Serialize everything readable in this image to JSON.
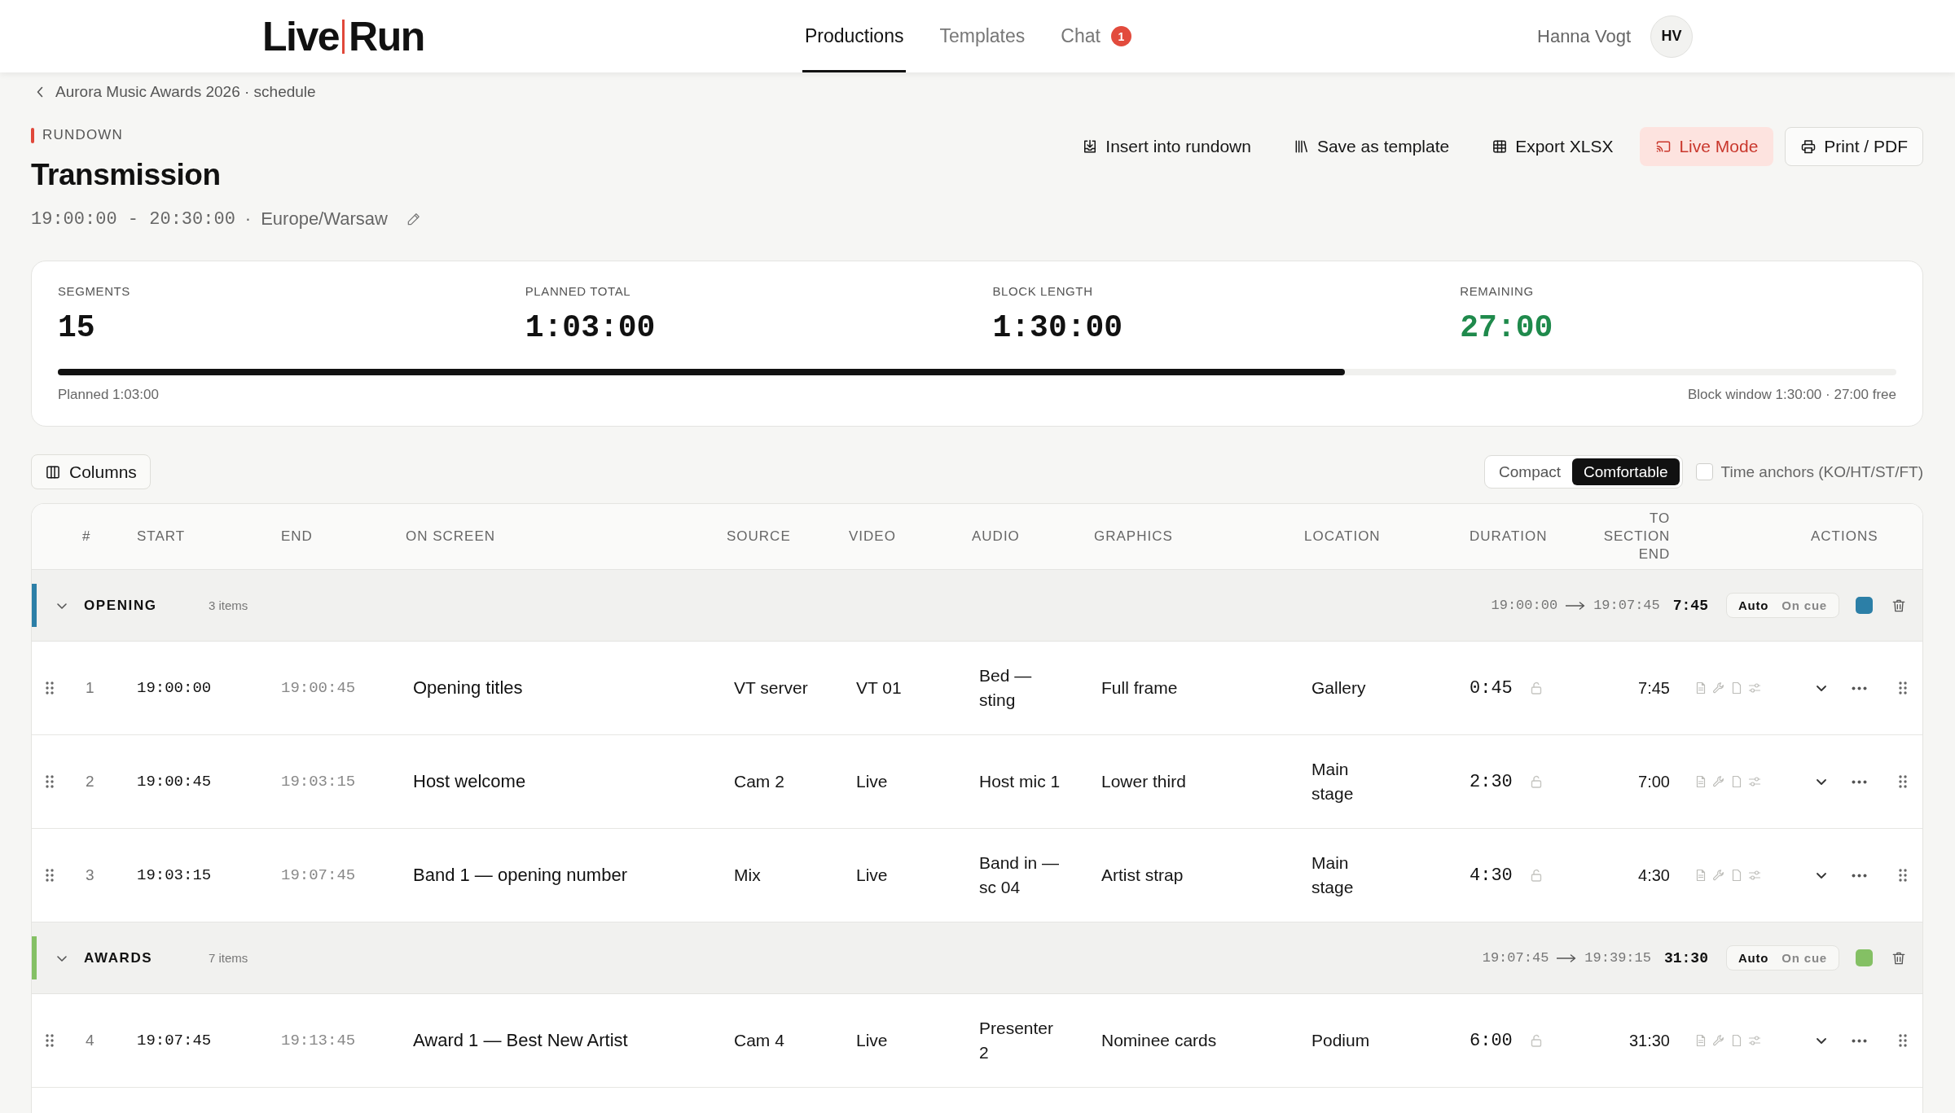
{
  "header": {
    "logo": {
      "left": "Live",
      "right": "Run"
    },
    "nav": [
      {
        "label": "Productions",
        "selected": true
      },
      {
        "label": "Templates",
        "selected": false
      },
      {
        "label": "Chat",
        "selected": false,
        "badge": "1"
      }
    ],
    "user": {
      "name": "Hanna Vogt",
      "initials": "HV"
    }
  },
  "breadcrumb": {
    "label": "Aurora Music Awards 2026 · schedule"
  },
  "page": {
    "eyebrow": "RUNDOWN",
    "title": "Transmission",
    "time_range": "19:00:00 - 20:30:00",
    "separator": "·",
    "timezone": "Europe/Warsaw"
  },
  "actions": [
    {
      "label": "Insert into rundown",
      "kind": "insert"
    },
    {
      "label": "Save as template",
      "kind": "template"
    },
    {
      "label": "Export XLSX",
      "kind": "export"
    },
    {
      "label": "Live Mode",
      "kind": "live"
    },
    {
      "label": "Print / PDF",
      "kind": "print"
    }
  ],
  "summary": {
    "stats": [
      {
        "label": "SEGMENTS",
        "value": "15",
        "kind": "neutral"
      },
      {
        "label": "PLANNED TOTAL",
        "value": "1:03:00",
        "kind": "neutral"
      },
      {
        "label": "BLOCK LENGTH",
        "value": "1:30:00",
        "kind": "neutral"
      },
      {
        "label": "REMAINING",
        "value": "27:00",
        "kind": "positive"
      }
    ],
    "progress": {
      "level": 0.7
    },
    "planned_note": "Planned 1:03:00",
    "window_note": "Block window 1:30:00 · 27:00 free"
  },
  "toolbar": {
    "columns_button": "Columns",
    "density": [
      {
        "label": "Compact",
        "selected": false
      },
      {
        "label": "Comfortable",
        "selected": true
      }
    ],
    "time_anchors": {
      "label": "Time anchors (KO/HT/ST/FT)",
      "checked": false
    }
  },
  "table": {
    "columns": [
      "#",
      "START",
      "END",
      "ON SCREEN",
      "SOURCE",
      "VIDEO",
      "AUDIO",
      "GRAPHICS",
      "LOCATION",
      "DURATION",
      "TO SECTION END",
      "ACTIONS"
    ],
    "sections": [
      {
        "name": "OPENING",
        "count": "3 items",
        "color": "#2c7fa7",
        "expanded": true,
        "range_start": "19:00:00",
        "range_end": "19:07:45",
        "total": "7:45",
        "modes": [
          {
            "label": "Auto",
            "selected": true
          },
          {
            "label": "On cue",
            "selected": false
          }
        ],
        "rows": [
          {
            "number": "1",
            "start": "19:00:00",
            "end": "19:00:45",
            "on_screen": "Opening titles",
            "source": "VT server",
            "video": "VT 01",
            "audio": "Bed — sting",
            "graphics": "Full frame",
            "location": "Gallery",
            "duration": "0:45",
            "to_section_end": "7:45"
          },
          {
            "number": "2",
            "start": "19:00:45",
            "end": "19:03:15",
            "on_screen": "Host welcome",
            "source": "Cam 2",
            "video": "Live",
            "audio": "Host mic 1",
            "graphics": "Lower third",
            "location": "Main stage",
            "duration": "2:30",
            "to_section_end": "7:00"
          },
          {
            "number": "3",
            "start": "19:03:15",
            "end": "19:07:45",
            "on_screen": "Band 1 — opening number",
            "source": "Mix",
            "video": "Live",
            "audio": "Band in — sc 04",
            "graphics": "Artist strap",
            "location": "Main stage",
            "duration": "4:30",
            "to_section_end": "4:30"
          }
        ]
      },
      {
        "name": "AWARDS",
        "count": "7 items",
        "color": "#84c064",
        "expanded": true,
        "range_start": "19:07:45",
        "range_end": "19:39:15",
        "total": "31:30",
        "modes": [
          {
            "label": "Auto",
            "selected": true
          },
          {
            "label": "On cue",
            "selected": false
          }
        ],
        "rows": [
          {
            "number": "4",
            "start": "19:07:45",
            "end": "19:13:45",
            "on_screen": "Award 1 — Best New Artist",
            "source": "Cam 4",
            "video": "Live",
            "audio": "Presenter 2",
            "graphics": "Nominee cards",
            "location": "Podium",
            "duration": "6:00",
            "to_section_end": "31:30"
          }
        ]
      }
    ]
  }
}
